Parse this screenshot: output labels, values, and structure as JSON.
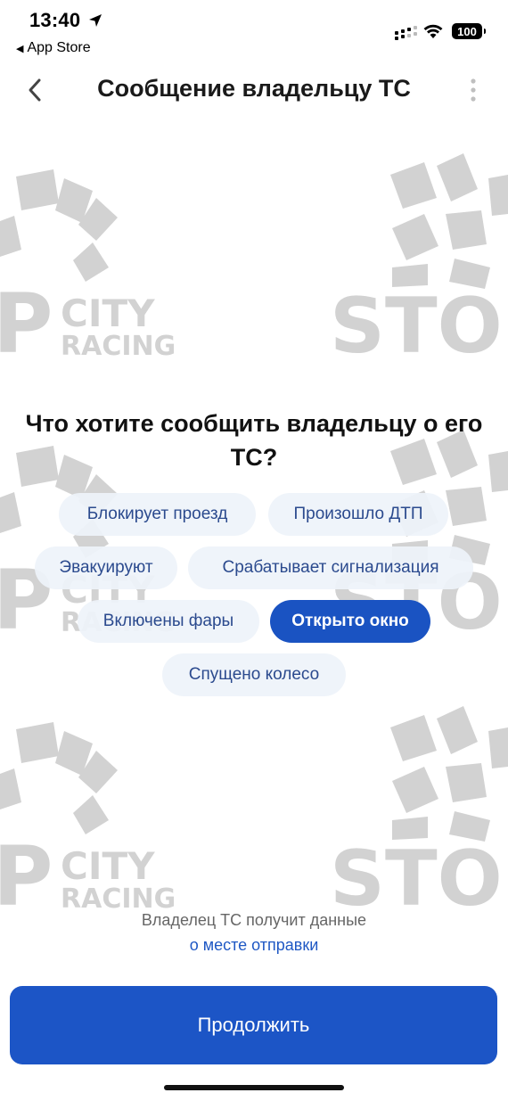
{
  "status_bar": {
    "time": "13:40",
    "back_to_app": "App Store",
    "battery": "100"
  },
  "nav": {
    "title": "Сообщение владельцу ТС"
  },
  "question": "Что хотите сообщить владельцу о его ТС?",
  "options": [
    {
      "label": "Блокирует проезд",
      "selected": false
    },
    {
      "label": "Произошло ДТП",
      "selected": false
    },
    {
      "label": "Эвакуируют",
      "selected": false
    },
    {
      "label": "Срабатывает сигнализация",
      "selected": false
    },
    {
      "label": "Включены фары",
      "selected": false
    },
    {
      "label": "Открыто окно",
      "selected": true
    },
    {
      "label": "Спущено колесо",
      "selected": false
    }
  ],
  "footnote": {
    "line1": "Владелец ТС получит данные",
    "link": "о месте отправки"
  },
  "continue_button": "Продолжить",
  "watermark": {
    "city": "CITY",
    "racing": "RACING",
    "p": "P",
    "stor": "STOR"
  },
  "colors": {
    "accent": "#1c55c6",
    "chip_bg": "#eef3fa",
    "chip_text": "#2b4a8e"
  }
}
